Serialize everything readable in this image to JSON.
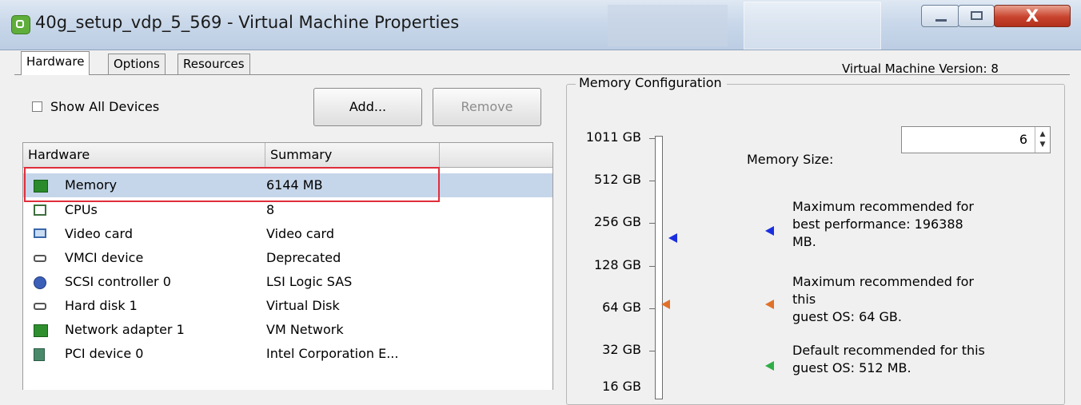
{
  "window": {
    "title": "40g_setup_vdp_5_569 - Virtual Machine Properties",
    "close_glyph": "X"
  },
  "tabs": [
    {
      "label": "Hardware",
      "active": true
    },
    {
      "label": "Options",
      "active": false
    },
    {
      "label": "Resources",
      "active": false
    }
  ],
  "vm_version": "Virtual Machine Version: 8",
  "toolbar": {
    "show_all_devices": "Show All Devices",
    "add_label": "Add...",
    "remove_label": "Remove"
  },
  "hardware_list": {
    "columns": [
      "Hardware",
      "Summary"
    ],
    "rows": [
      {
        "icon": "memory-icon",
        "name": "Memory",
        "summary": "6144 MB",
        "selected": true
      },
      {
        "icon": "cpu-icon",
        "name": "CPUs",
        "summary": "8"
      },
      {
        "icon": "video-card-icon",
        "name": "Video card",
        "summary": "Video card"
      },
      {
        "icon": "vmci-device-icon",
        "name": "VMCI device",
        "summary": "Deprecated"
      },
      {
        "icon": "scsi-controller-icon",
        "name": "SCSI controller 0",
        "summary": "LSI Logic SAS"
      },
      {
        "icon": "hard-disk-icon",
        "name": "Hard disk 1",
        "summary": "Virtual Disk"
      },
      {
        "icon": "network-adapter-icon",
        "name": "Network adapter 1",
        "summary": "VM Network"
      },
      {
        "icon": "pci-device-icon",
        "name": "PCI device 0",
        "summary": "Intel Corporation E..."
      }
    ]
  },
  "memory_config": {
    "legend": "Memory Configuration",
    "scale_labels": [
      "1011 GB",
      "512 GB",
      "256 GB",
      "128 GB",
      "64 GB",
      "32 GB",
      "16 GB"
    ],
    "memory_size_label": "Memory Size:",
    "memory_size_value": "6",
    "spin_up": "▲",
    "spin_down": "▼",
    "recommendations": [
      {
        "marker": "blue",
        "lines": [
          "Maximum recommended for",
          "best performance: 196388",
          "MB."
        ]
      },
      {
        "marker": "orange",
        "lines": [
          "Maximum recommended for",
          "this",
          "guest OS: 64 GB."
        ]
      },
      {
        "marker": "green",
        "lines": [
          "Default recommended for this",
          "guest OS: 512 MB."
        ]
      }
    ]
  },
  "colors": {
    "selection_outline": "#e02d3a",
    "selected_row": "#c6d6ea",
    "marker_blue": "#1a2ee0",
    "marker_orange": "#e0712b",
    "marker_green": "#2fae46"
  }
}
